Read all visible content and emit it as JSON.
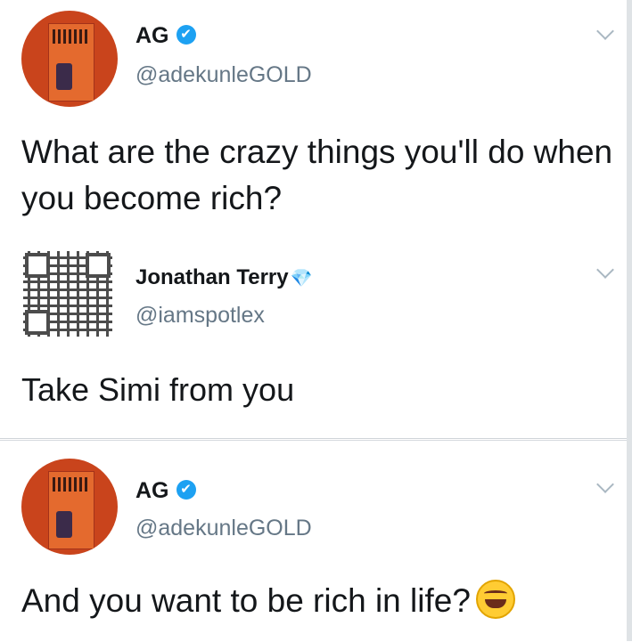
{
  "tweets": [
    {
      "name": "AG",
      "handle": "@adekunleGOLD",
      "text": "What are the crazy things you'll do when you become rich?",
      "verified_color": "#1da1f2",
      "avatar": "album-cover-avatar"
    },
    {
      "name": "Jonathan Terry",
      "handle": "@iamspotlex",
      "text": "Take Simi from you",
      "badge_icon": "diamond-icon",
      "avatar": "qr-code-avatar"
    },
    {
      "name": "AG",
      "handle": "@adekunleGOLD",
      "text": "And you want to be rich in life?",
      "emoji": "rolling-on-floor-laughing-icon",
      "verified_color": "#1da1f2",
      "avatar": "album-cover-avatar"
    }
  ],
  "icons": {
    "verified": "✔",
    "diamond": "💎"
  }
}
